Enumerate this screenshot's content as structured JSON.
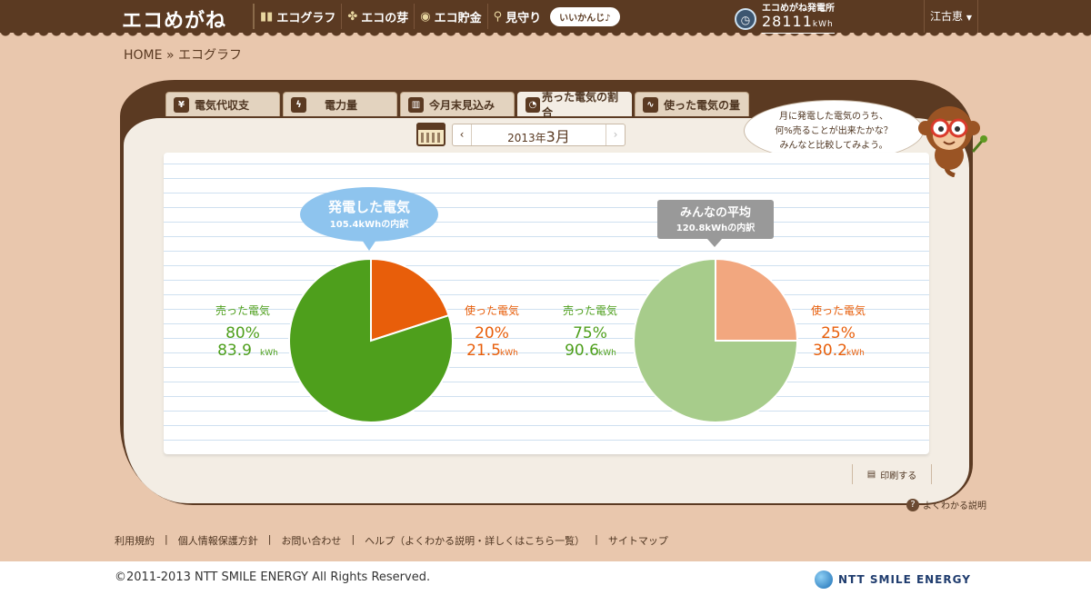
{
  "header": {
    "logo": "エコめがね",
    "nav": [
      {
        "label": "エコグラフ",
        "icon": "bar-chart-icon"
      },
      {
        "label": "エコの芽",
        "icon": "sprout-icon"
      },
      {
        "label": "エコ貯金",
        "icon": "coin-icon"
      },
      {
        "label": "見守り",
        "icon": "magnifier-icon"
      }
    ],
    "nav_badge": "いいかんじ♪",
    "station_title": "エコめがね発電所",
    "station_value": "28111",
    "station_unit": "kWh",
    "user": "江古恵"
  },
  "breadcrumb": {
    "home": "HOME",
    "sep": "»",
    "current": "エコグラフ"
  },
  "tabs": [
    {
      "label": "電気代収支",
      "icon": "yen-icon"
    },
    {
      "label": "電力量",
      "icon": "bolt-icon"
    },
    {
      "label": "今月末見込み",
      "icon": "forecast-icon"
    },
    {
      "label": "売った電気の割合",
      "icon": "pie-icon"
    },
    {
      "label": "使った電気の量",
      "icon": "wave-icon"
    }
  ],
  "date_nav": {
    "prev": "‹",
    "year": "2013年",
    "month": "3月",
    "next": "›"
  },
  "bubble": {
    "line1": "月に発電した電気のうち、",
    "line2": "何%売ることが出来たかな？",
    "line3": "みんなと比較してみよう。"
  },
  "chart_data": [
    {
      "type": "pie",
      "title": "発電した電気",
      "subtitle": "105.4kWhの内訳",
      "slices": [
        {
          "label": "売った電気",
          "percent": 80,
          "kwh": 83.9,
          "color": "#4e9f1c"
        },
        {
          "label": "使った電気",
          "percent": 20,
          "kwh": 21.5,
          "color": "#e85e0a"
        }
      ],
      "unit": "kWh",
      "title_color": "#8ec4ee"
    },
    {
      "type": "pie",
      "title": "みんなの平均",
      "subtitle": "120.8kWhの内訳",
      "slices": [
        {
          "label": "売った電気",
          "percent": 75,
          "kwh": 90.6,
          "color": "#a7cc8b"
        },
        {
          "label": "使った電気",
          "percent": 25,
          "kwh": 30.2,
          "color": "#f2a77f"
        }
      ],
      "unit": "kWh",
      "title_color": "#999999"
    }
  ],
  "chart_labels": {
    "p1_sold_label": "売った電気",
    "p1_sold_pct": "80%",
    "p1_sold_kwh": "83.9",
    "p1_used_label": "使った電気",
    "p1_used_pct": "20%",
    "p1_used_kwh": "21.5",
    "p2_sold_label": "売った電気",
    "p2_sold_pct": "75%",
    "p2_sold_kwh": "90.6",
    "p2_used_label": "使った電気",
    "p2_used_pct": "25%",
    "p2_used_kwh": "30.2",
    "unit": "kWh"
  },
  "actions": {
    "print": "印刷する",
    "help": "よくわかる説明"
  },
  "footer": {
    "links": [
      "利用規約",
      "個人情報保護方針",
      "お問い合わせ",
      "ヘルプ（よくわかる説明・詳しくはこちら一覧）",
      "サイトマップ"
    ],
    "sep": "|",
    "copyright": "©2011-2013 NTT SMILE ENERGY All Rights Reserved.",
    "brand": "NTT SMILE ENERGY"
  }
}
